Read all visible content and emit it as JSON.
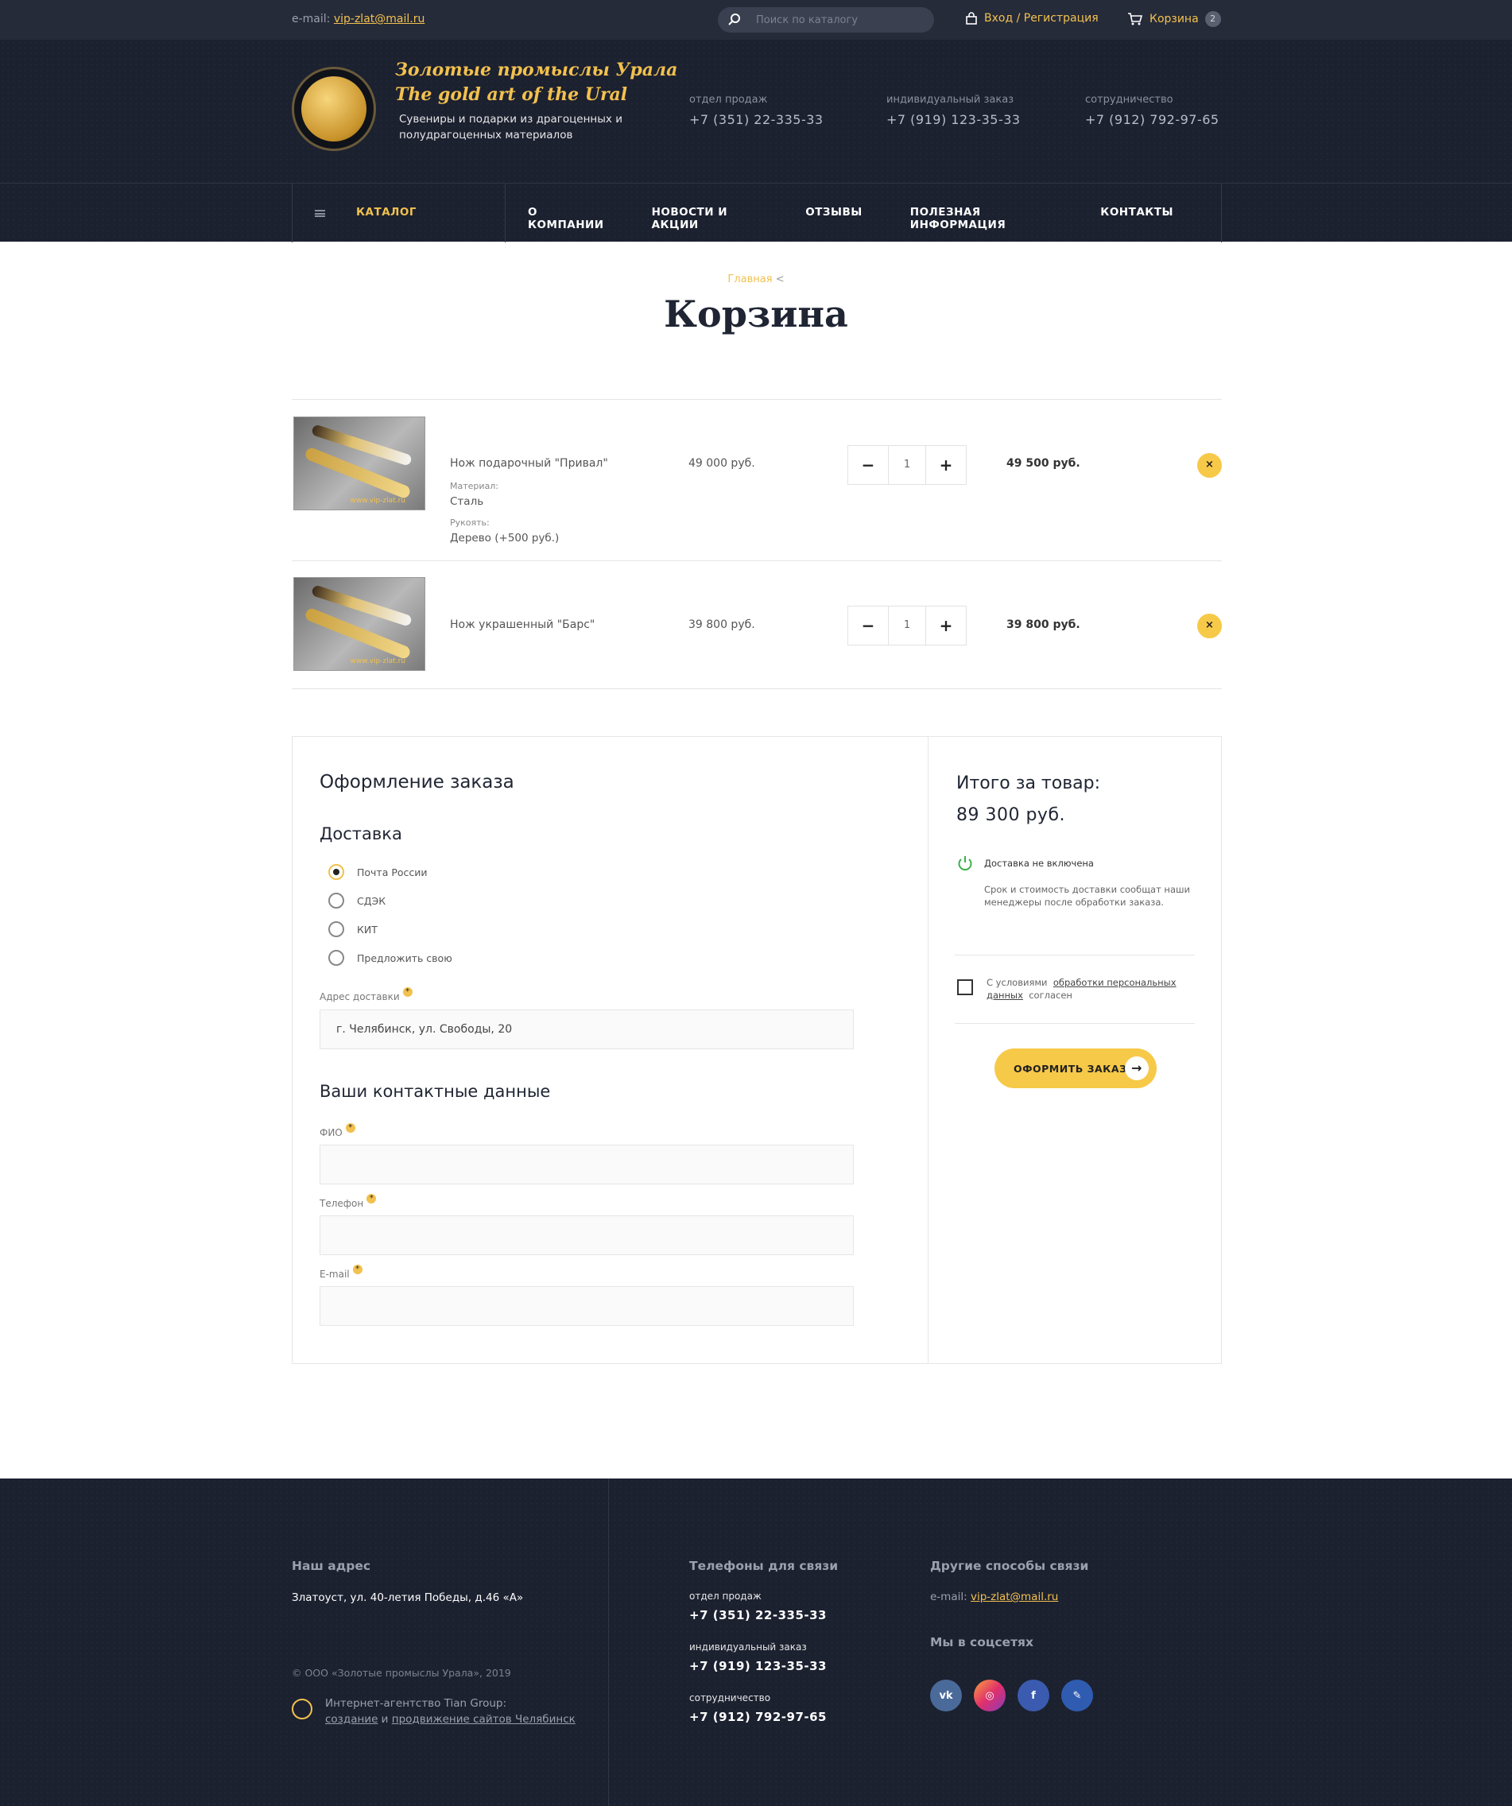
{
  "topbar": {
    "email_label": "e-mail:",
    "email": "vip-zlat@mail.ru",
    "search_placeholder": "Поиск по каталогу",
    "login": "Вход / Регистрация",
    "cart_label": "Корзина",
    "cart_count": "2"
  },
  "header": {
    "brand_ru": "Золотые промыслы Урала",
    "brand_en": "The gold art of the Ural",
    "tagline": "Сувениры и подарки из драгоценных и полудрагоценных материалов",
    "contacts": [
      {
        "label": "отдел продаж",
        "phone": "+7 (351) 22-335-33"
      },
      {
        "label": "индивидуальный заказ",
        "phone": "+7 (919) 123-35-33"
      },
      {
        "label": "сотрудничество",
        "phone": "+7 (912) 792-97-65"
      }
    ]
  },
  "nav": {
    "catalog": "КАТАЛОГ",
    "items": [
      "О КОМПАНИИ",
      "НОВОСТИ И АКЦИИ",
      "ОТЗЫВЫ",
      "ПОЛЕЗНАЯ ИНФОРМАЦИЯ",
      "КОНТАКТЫ"
    ]
  },
  "page": {
    "breadcrumb_home": "Главная",
    "breadcrumb_sep": "<",
    "title": "Корзина"
  },
  "cart": {
    "items": [
      {
        "name": "Нож подарочный \"Привал\"",
        "price": "49 000 руб.",
        "qty": "1",
        "total": "49 500 руб.",
        "watermark": "www.vip-zlat.ru",
        "attrs": [
          {
            "label": "Материал:",
            "value": "Сталь"
          },
          {
            "label": "Рукоять:",
            "value": "Дерево (+500 руб.)"
          }
        ]
      },
      {
        "name": "Нож украшенный \"Барс\"",
        "price": "39 800 руб.",
        "qty": "1",
        "total": "39 800 руб.",
        "watermark": "www.vip-zlat.ru",
        "attrs": []
      }
    ],
    "minus": "−",
    "plus": "+",
    "remove": "×"
  },
  "order": {
    "title": "Оформление заказа",
    "delivery_title": "Доставка",
    "delivery_options": [
      "Почта России",
      "СДЭК",
      "КИТ",
      "Предложить свою"
    ],
    "delivery_selected": 0,
    "address_label": "Адрес доставки",
    "address_value": "г. Челябинск, ул. Свободы, 20",
    "contacts_title": "Ваши контактные данные",
    "fio_label": "ФИО",
    "phone_label": "Телефон",
    "email_label": "E-mail",
    "required_mark": "*"
  },
  "summary": {
    "title": "Итого за товар:",
    "total": "89 300 руб.",
    "note_title": "Доставка не включена",
    "note_text": "Срок и стоимость доставки сообщат наши менеджеры после обработки заказа.",
    "agree_prefix": "С условиями",
    "agree_link": "обработки персональных данных",
    "agree_suffix": "согласен",
    "button": "ОФОРМИТЬ ЗАКАЗ",
    "button_arrow": "→"
  },
  "footer": {
    "address_title": "Наш адрес",
    "address": "Златоуст, ул. 40-летия Победы, д.46 «А»",
    "copyright": "© ООО «Золотые промыслы Урала», 2019",
    "agency_title": "Интернет-агентство Tian Group:",
    "agency_link1": "создание",
    "agency_and": "и",
    "agency_link2": "продвижение сайтов Челябинск",
    "phones_title": "Телефоны для связи",
    "phones": [
      {
        "label": "отдел продаж",
        "phone": "+7 (351) 22-335-33"
      },
      {
        "label": "индивидуальный заказ",
        "phone": "+7 (919) 123-35-33"
      },
      {
        "label": "сотрудничество",
        "phone": "+7 (912) 792-97-65"
      }
    ],
    "other_title": "Другие способы связи",
    "email_label": "e-mail:",
    "email": "vip-zlat@mail.ru",
    "social_title": "Мы в соцсетях",
    "social": [
      {
        "icon": "vk-icon",
        "glyph": "vk",
        "color": "#4a6a9a"
      },
      {
        "icon": "instagram-icon",
        "glyph": "◎",
        "color": "#e1306c"
      },
      {
        "icon": "facebook-icon",
        "glyph": "f",
        "color": "#3b5bb0"
      },
      {
        "icon": "paperclip-icon",
        "glyph": "✎",
        "color": "#2f5cb0"
      }
    ]
  },
  "colors": {
    "accent": "#f2c14e",
    "dark": "#1c2130",
    "button": "#f7c948"
  }
}
